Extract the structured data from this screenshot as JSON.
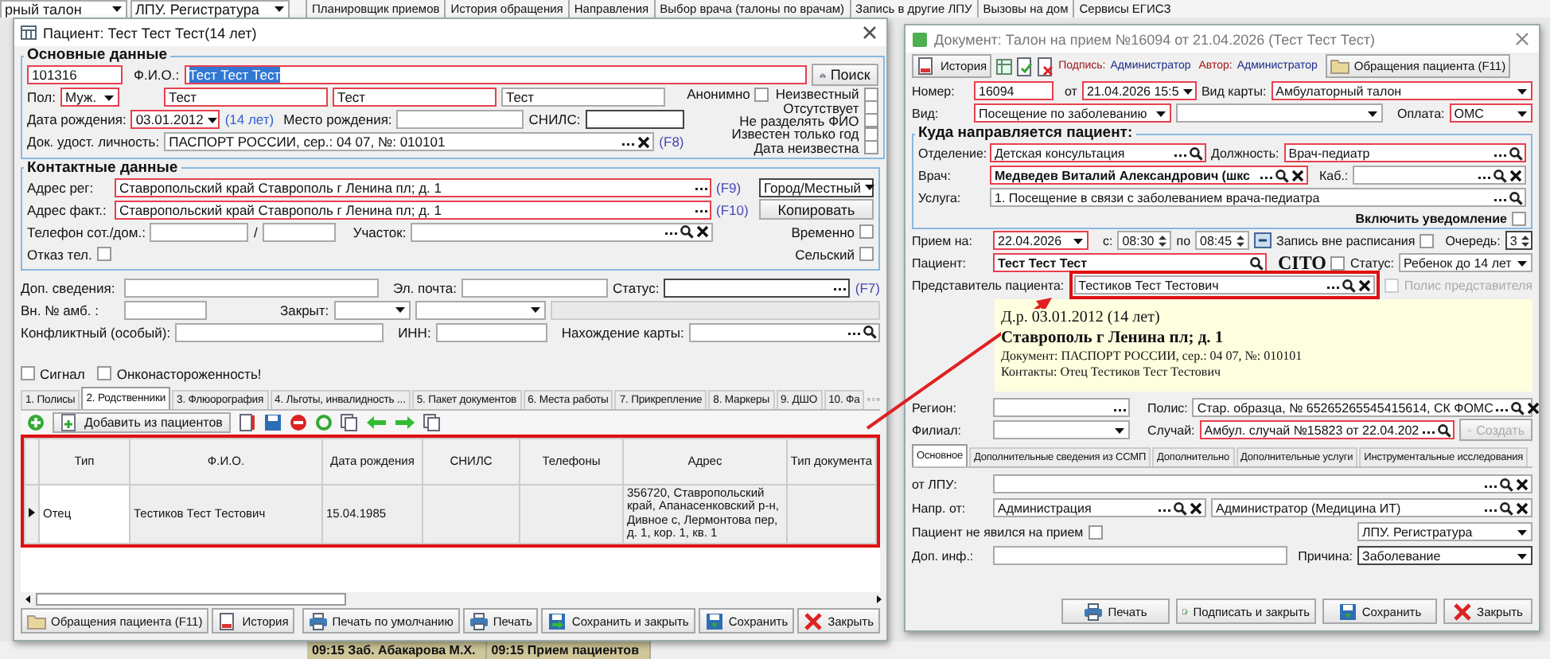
{
  "background": {
    "fields": [
      "рный талон",
      "ЛПУ. Регистратура"
    ],
    "tabs": [
      "Планировщик приемов",
      "История обращения",
      "Направления",
      "Выбор врача (талоны по врачам)",
      "Запись в другие ЛПУ",
      "Вызовы на дом",
      "Сервисы ЕГИСЗ"
    ],
    "schedule": [
      "09:15  Заб. Абакарова М.Х.",
      "09:15  Прием пациентов"
    ]
  },
  "patient": {
    "title": "Пациент: Тест Тест Тест(14 лет)",
    "main": {
      "title": "Основные данные",
      "card": {
        "value": "101316",
        "required": true
      },
      "fio_label": "Ф.И.О.:",
      "fio": {
        "value": "Тест Тест Тест",
        "required": true,
        "text_selected": true
      },
      "search_button": "Поиск",
      "sex_label": "Пол:",
      "sex": {
        "value": "Муж.",
        "required": true
      },
      "name_parts": [
        {
          "value": "Тест",
          "required": true
        },
        {
          "value": "Тест",
          "required": true
        },
        {
          "value": "Тест",
          "required": false
        }
      ],
      "birth_label": "Дата рождения:",
      "birth_date": {
        "value": "03.01.2012",
        "required": true
      },
      "age": "(14 лет)",
      "birthplace_label": "Место рождения:",
      "snils_label": "СНИЛС:",
      "doc_label": "Док. удост. личность:",
      "doc": "ПАСПОРТ РОССИИ, сер.: 04 07, №: 010101",
      "doc_hotkey": "(F8)",
      "flags": [
        {
          "label": "Анонимно",
          "checked": false
        },
        {
          "label": "Неизвестный",
          "checked": false
        },
        {
          "label": "Отсутствует",
          "checked": false
        },
        {
          "label": "Не разделять ФИО",
          "checked": false
        },
        {
          "label": "Известен только год",
          "checked": false
        },
        {
          "label": "Дата неизвестна",
          "checked": false
        }
      ]
    },
    "contacts": {
      "title": "Контактные данные",
      "reg_label": "Адрес рег:",
      "reg": {
        "value": "Ставропольский край Ставрополь г Ленина пл; д. 1",
        "required": true
      },
      "reg_hotkey": "(F9)",
      "locality": "Город/Местный",
      "fact_label": "Адрес факт.:",
      "fact": {
        "value": "Ставропольский край Ставрополь г Ленина пл; д. 1",
        "required": true
      },
      "fact_hotkey": "(F10)",
      "copy_button": "Копировать",
      "phone_label": "Телефон сот./дом.:",
      "phone_sep": "/",
      "area_label": "Участок:",
      "flags": [
        {
          "label": "Временно",
          "checked": false
        },
        {
          "label": "Отказ тел.",
          "checked": false
        },
        {
          "label": "Сельский",
          "checked": false
        }
      ]
    },
    "extra": {
      "info_label": "Доп. сведения:",
      "email_label": "Эл. почта:",
      "status_label": "Статус:",
      "status_hotkey": "(F7)",
      "amb_label": "Вн. № амб. :",
      "closed_label": "Закрыт:",
      "conflict_label": "Конфликтный (особый):",
      "inn_label": "ИНН:",
      "location_label": "Нахождение карты:",
      "flags": [
        {
          "label": "Сигнал",
          "checked": false
        },
        {
          "label": "Онконастороженность!",
          "checked": false
        }
      ]
    },
    "tabs": [
      {
        "label": "1. Полисы",
        "selected": false
      },
      {
        "label": "2. Родственники",
        "selected": true
      },
      {
        "label": "3. Флюорография",
        "selected": false
      },
      {
        "label": "4. Льготы, инвалидность ...",
        "selected": false
      },
      {
        "label": "5. Пакет документов",
        "selected": false
      },
      {
        "label": "6. Места работы",
        "selected": false
      },
      {
        "label": "7. Прикрепление",
        "selected": false
      },
      {
        "label": "8. Маркеры",
        "selected": false
      },
      {
        "label": "9. ДШО",
        "selected": false
      },
      {
        "label": "10. Фа",
        "selected": false
      }
    ],
    "add_button": "Добавить из пациентов",
    "table": {
      "columns": [
        "Тип",
        "Ф.И.О.",
        "Дата рождения",
        "СНИЛС",
        "Телефоны",
        "Адрес",
        "Тип документа"
      ],
      "rows": [
        {
          "type": "Отец",
          "name": "Тестиков Тест Тестович",
          "birth_date": "15.04.1985",
          "address": "356720, Ставропольский край, Апанасенковский р-н, Дивное с, Лермонтова пер, д. 1, кор. 1, кв. 1",
          "selected": true
        }
      ]
    },
    "footer_left": [
      {
        "label": "Обращения пациента (F11)",
        "kind": "appeals"
      },
      {
        "label": "История",
        "kind": "history"
      }
    ],
    "footer_right": [
      {
        "label": "Печать по умолчанию",
        "kind": "print_default"
      },
      {
        "label": "Печать",
        "kind": "print"
      },
      {
        "label": "Сохранить и закрыть",
        "kind": "save_close"
      },
      {
        "label": "Сохранить",
        "kind": "save"
      },
      {
        "label": "Закрыть",
        "kind": "close"
      }
    ]
  },
  "ticket": {
    "title": "Документ: Талон на прием №16094 от 21.04.2026 (Тест Тест Тест)",
    "history_button": "История",
    "sign_label": "Подпись:",
    "sign_value": "Администратор",
    "author_label": "Автор:",
    "author_value": "Администратор",
    "appeals_button": "Обращения пациента (F11)",
    "number_label": "Номер:",
    "number": {
      "value": "16094",
      "required": true
    },
    "from_label": "от",
    "date": {
      "value": "21.04.2026 15:5",
      "required": true
    },
    "card_type_label": "Вид карты:",
    "card_type": {
      "value": "Амбулаторный талон",
      "required": true
    },
    "kind_label": "Вид:",
    "visit_kind": {
      "value": "Посещение по заболеванию",
      "required": true
    },
    "payment_label": "Оплата:",
    "payment": {
      "value": "ОМС",
      "required": true
    },
    "group_title": "Куда направляется пациент:",
    "dept_label": "Отделение:",
    "dept": {
      "value": "Детская консультация",
      "required": true
    },
    "position_label": "Должность:",
    "position": {
      "value": "Врач-педиатр",
      "required": true
    },
    "doctor_label": "Врач:",
    "doctor": {
      "value": "Медведев Виталий Александрович (шкс",
      "required": true
    },
    "room_label": "Каб.:",
    "service_label": "Услуга:",
    "service": "1. Посещение в связи с заболеванием врача-педиатра",
    "notify": {
      "label": "Включить уведомление",
      "checked": false
    },
    "date_label": "Прием на:",
    "visit_date": {
      "value": "22.04.2026",
      "required": true
    },
    "from_time_label": "с:",
    "from_time": "08:30",
    "to_time_label": "по",
    "to_time": "08:45",
    "unscheduled": {
      "label": "Запись вне расписания",
      "checked": false
    },
    "queue_label": "Очередь:",
    "queue": "3",
    "patient_label": "Пациент:",
    "patient": {
      "value": "Тест Тест Тест",
      "required": true
    },
    "cito": {
      "label": "CITO",
      "checked": false
    },
    "status_label": "Статус:",
    "status": "Ребенок до 14 лет",
    "rep_label": "Представитель пациента:",
    "representative": "Тестиков Тест Тестович",
    "rep_policy": {
      "label": "Полис представителя",
      "checked": false,
      "disabled": true
    },
    "info": [
      "Д.р. 03.01.2012 (14 лет)",
      "Ставрополь г Ленина пл; д. 1",
      "Документ: ПАСПОРТ РОССИИ, сер.: 04 07, №: 010101",
      "Контакты: Отец Тестиков Тест Тестович"
    ],
    "region_label": "Регион:",
    "policy_label": "Полис:",
    "policy": "Стар. образца, № 65265265545415614, СК ФОМС",
    "branch_label": "Филиал:",
    "case_label": "Случай:",
    "case": {
      "value": "Амбул. случай №15823 от 22.04.202",
      "required": true
    },
    "create_button": {
      "label": "Создать",
      "disabled": true
    },
    "tabs": [
      {
        "label": "Основное",
        "selected": true
      },
      {
        "label": "Дополнительные сведения из ССМП",
        "selected": false
      },
      {
        "label": "Дополнительно",
        "selected": false
      },
      {
        "label": "Дополнительные услуги",
        "selected": false
      },
      {
        "label": "Инструментальные исследования",
        "selected": false
      }
    ],
    "lpu_label": "от ЛПУ:",
    "referral_label": "Напр. от:",
    "referral": [
      "Администрация",
      "Администратор (Медицина ИТ)"
    ],
    "no_show": {
      "label": "Пациент не явился на прием",
      "checked": false
    },
    "registry": "ЛПУ. Регистратура",
    "note_label": "Доп. инф.:",
    "reason_label": "Причина:",
    "reason": "Заболевание",
    "footer": [
      {
        "label": "Печать",
        "kind": "print"
      },
      {
        "label": "Подписать и закрыть",
        "kind": "sign"
      },
      {
        "label": "Сохранить",
        "kind": "save"
      },
      {
        "label": "Закрыть",
        "kind": "close"
      }
    ]
  }
}
